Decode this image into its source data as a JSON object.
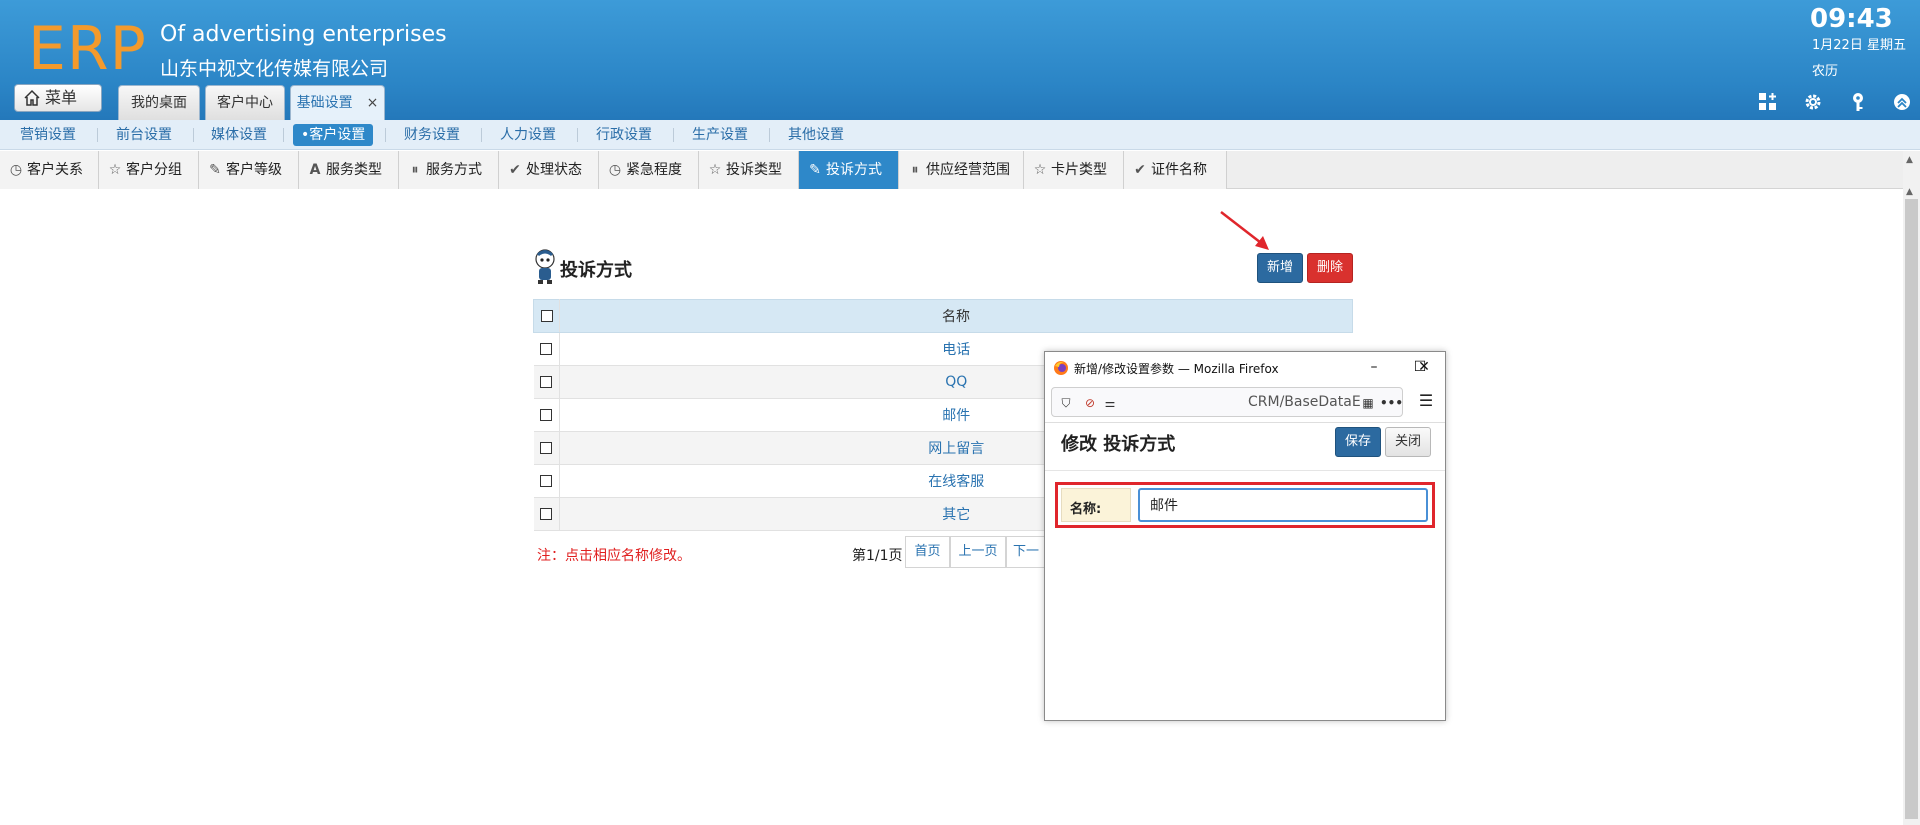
{
  "header": {
    "logo": "ERP",
    "brand_en": "Of advertising enterprises",
    "brand_cn": "山东中视文化传媒有限公司",
    "time": "09:43",
    "date": "1月22日 星期五",
    "lunar": "农历",
    "menu_label": "菜单",
    "tabs": [
      {
        "label": "我的桌面"
      },
      {
        "label": "客户中心"
      },
      {
        "label": "基础设置",
        "close": "×"
      }
    ],
    "icons": [
      "grid-add-icon",
      "gear-icon",
      "key-icon",
      "collapse-up-icon"
    ]
  },
  "subnav": {
    "items": [
      "营销设置",
      "前台设置",
      "媒体设置",
      "•客户设置",
      "财务设置",
      "人力设置",
      "行政设置",
      "生产设置",
      "其他设置"
    ],
    "active": "•客户设置"
  },
  "category_tabs": {
    "items": [
      {
        "label": "客户关系",
        "icon": "clock-icon"
      },
      {
        "label": "客户分组",
        "icon": "star-icon"
      },
      {
        "label": "客户等级",
        "icon": "pencil-icon"
      },
      {
        "label": "服务类型",
        "icon": "letter-a-icon"
      },
      {
        "label": "服务方式",
        "icon": "pause-circle-icon"
      },
      {
        "label": "处理状态",
        "icon": "check-icon"
      },
      {
        "label": "紧急程度",
        "icon": "clock-icon"
      },
      {
        "label": "投诉类型",
        "icon": "star-icon"
      },
      {
        "label": "投诉方式",
        "icon": "pencil-icon"
      },
      {
        "label": "供应经营范围",
        "icon": "pause-circle-icon"
      },
      {
        "label": "卡片类型",
        "icon": "star-icon"
      },
      {
        "label": "证件名称",
        "icon": "check-icon"
      }
    ],
    "active": "投诉方式"
  },
  "content": {
    "title": "投诉方式",
    "add_label": "新增",
    "delete_label": "删除",
    "table": {
      "header": "名称",
      "rows": [
        "电话",
        "QQ",
        "邮件",
        "网上留言",
        "在线客服",
        "其它"
      ]
    },
    "note": "注：点击相应名称修改。",
    "page_info": "第1/1页",
    "pager": [
      "首页",
      "上一页",
      "下一"
    ]
  },
  "popup": {
    "window_title": "新增/修改设置参数 — Mozilla Firefox",
    "url": "CRM/BaseDataE",
    "heading": "修改 投诉方式",
    "save_label": "保存",
    "close_label": "关闭",
    "field_label": "名称:",
    "field_value": "邮件",
    "controls": {
      "minimize": "–",
      "maximize": "☐",
      "close": "✕"
    }
  },
  "colors": {
    "header_blue": "#2b85c6",
    "logo_orange": "#f39a2c",
    "active_tab_blue": "#2e88c9",
    "add_button": "#2c6aa0",
    "delete_button": "#d9312e",
    "note_red": "#e02020",
    "highlight_red": "#e0262c"
  }
}
